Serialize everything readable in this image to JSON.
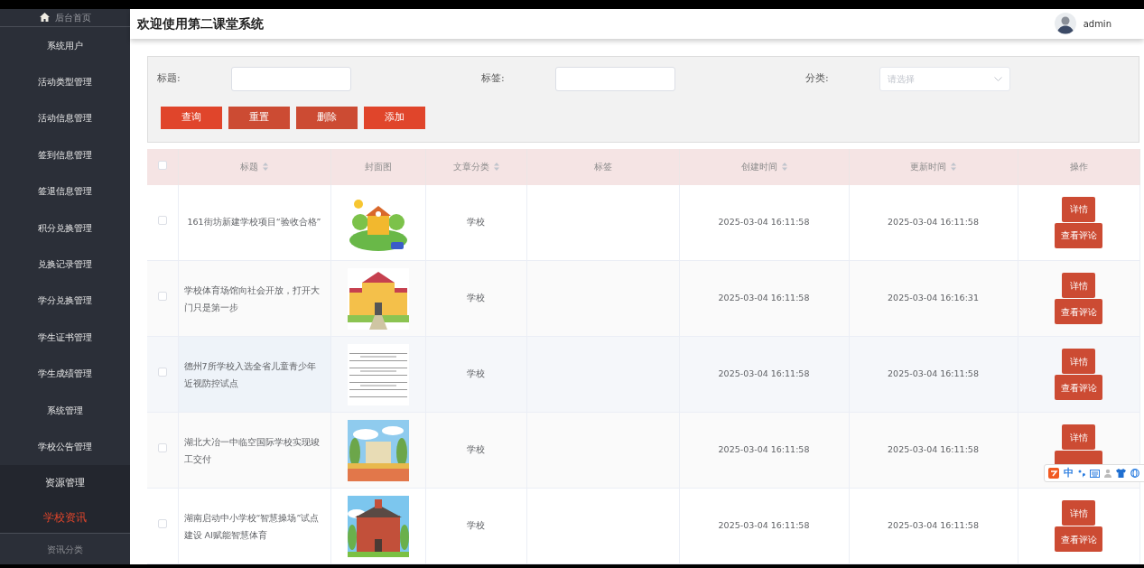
{
  "sidebar": {
    "home": "后台首页",
    "items": [
      {
        "label": "系统用户",
        "selected": false
      },
      {
        "label": "活动类型管理",
        "selected": false
      },
      {
        "label": "活动信息管理",
        "selected": false
      },
      {
        "label": "签到信息管理",
        "selected": false
      },
      {
        "label": "签退信息管理",
        "selected": false
      },
      {
        "label": "积分兑换管理",
        "selected": false
      },
      {
        "label": "兑换记录管理",
        "selected": false
      },
      {
        "label": "学分兑换管理",
        "selected": false
      },
      {
        "label": "学生证书管理",
        "selected": false
      },
      {
        "label": "学生成绩管理",
        "selected": false
      },
      {
        "label": "系统管理",
        "selected": false
      },
      {
        "label": "学校公告管理",
        "selected": false
      },
      {
        "label": "资源管理",
        "selected": false,
        "children": [
          {
            "label": "学校资讯",
            "selected": true
          },
          {
            "label": "资讯分类",
            "selected": false
          }
        ]
      }
    ]
  },
  "header": {
    "title": "欢迎使用第二课堂系统",
    "user": "admin"
  },
  "filters": [
    {
      "label": "标题:",
      "kind": "text"
    },
    {
      "label": "标签:",
      "kind": "text"
    },
    {
      "label": "分类:",
      "kind": "select",
      "placeholder": "请选择"
    }
  ],
  "buttons": [
    {
      "label": "查询",
      "color": "#e0452b"
    },
    {
      "label": "重置",
      "color": "#cc4b33"
    },
    {
      "label": "删除",
      "color": "#cc4b33"
    },
    {
      "label": "添加",
      "color": "#e0452b"
    }
  ],
  "table": {
    "all_checked": false,
    "columns": [
      {
        "label": "标题",
        "sortable": true
      },
      {
        "label": "封面图",
        "sortable": false
      },
      {
        "label": "文章分类",
        "sortable": true
      },
      {
        "label": "标签",
        "sortable": false
      },
      {
        "label": "创建时间",
        "sortable": true
      },
      {
        "label": "更新时间",
        "sortable": true
      },
      {
        "label": "操作",
        "sortable": false
      }
    ],
    "rows": [
      {
        "checked": false,
        "hovered": false,
        "title": "161街坊新建学校项目“验收合格”",
        "cover": {
          "kind": "picture"
        },
        "category": "学校",
        "created": "2025-03-04 16:11:58",
        "updated": "2025-03-04 16:11:58",
        "actions": [
          "详情",
          "查看评论"
        ]
      },
      {
        "checked": false,
        "hovered": false,
        "title": "学校体育场馆向社会开放，打开大门只是第一步",
        "cover": {
          "kind": "picture"
        },
        "category": "学校",
        "created": "2025-03-04 16:11:58",
        "updated": "2025-03-04 16:16:31",
        "actions": [
          "详情",
          "查看评论"
        ]
      },
      {
        "checked": false,
        "hovered": true,
        "title": "德州7所学校入选全省儿童青少年近视防控试点",
        "cover": {
          "kind": "picture"
        },
        "category": "学校",
        "created": "2025-03-04 16:11:58",
        "updated": "2025-03-04 16:11:58",
        "actions": [
          "详情",
          "查看评论"
        ]
      },
      {
        "checked": false,
        "hovered": false,
        "title": "湖北大冶一中临空国际学校实现竣工交付",
        "cover": {
          "kind": "picture"
        },
        "category": "学校",
        "created": "2025-03-04 16:11:58",
        "updated": "2025-03-04 16:11:58",
        "actions": [
          "详情"
        ],
        "covered_button": true
      },
      {
        "checked": false,
        "hovered": false,
        "title": "湖南启动中小学校“智慧操场”试点建设 AI赋能智慧体育",
        "cover": {
          "kind": "picture"
        },
        "category": "学校",
        "created": "2025-03-04 16:11:58",
        "updated": "2025-03-04 16:11:58",
        "actions": [
          "详情",
          "查看评论"
        ]
      }
    ]
  },
  "ime_toolbar": {
    "mode": "中"
  }
}
